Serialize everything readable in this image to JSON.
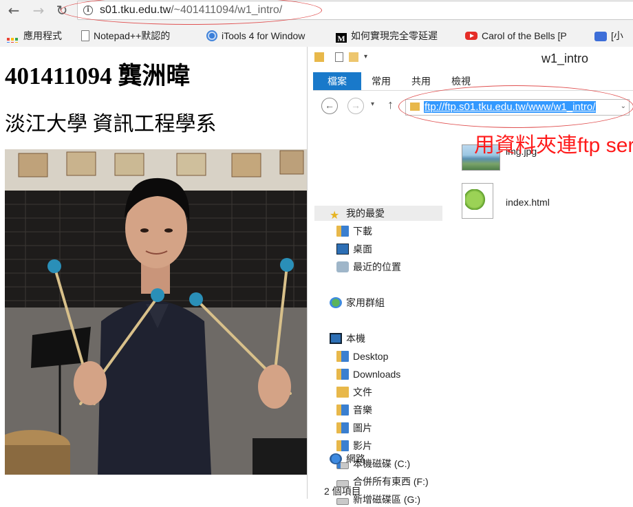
{
  "browser": {
    "url_host": "s01.tku.edu.tw",
    "url_path": "/~401411094/w1_intro/",
    "bookmarks": [
      {
        "label": "應用程式",
        "icon": "apps-icon"
      },
      {
        "label": "Notepad++默認的",
        "icon": "document-icon"
      },
      {
        "label": "iTools 4 for Window",
        "icon": "itools-icon"
      },
      {
        "label": "如何實現完全零延遲",
        "icon": "m-icon"
      },
      {
        "label": "Carol of the Bells [P",
        "icon": "youtube-icon"
      },
      {
        "label": "[小",
        "icon": "chat-icon"
      }
    ]
  },
  "page": {
    "student_heading": "401411094 龔洲暐",
    "dept_heading": "淡江大學 資訊工程學系"
  },
  "explorer": {
    "title": "w1_intro",
    "ribbon_tabs": [
      "檔案",
      "常用",
      "共用",
      "檢視"
    ],
    "address": "ftp://ftp.s01.tku.edu.tw/www/w1_intro/",
    "annotation": "用資料夾連ftp server",
    "nav_items": [
      {
        "label": "我的最愛",
        "icon": "star-icon"
      },
      {
        "label": "下載",
        "icon": "downloads-folder-icon"
      },
      {
        "label": "桌面",
        "icon": "desktop-icon"
      },
      {
        "label": "最近的位置",
        "icon": "recent-icon"
      },
      {
        "label": "家用群組",
        "icon": "homegroup-icon"
      },
      {
        "label": "本機",
        "icon": "pc-icon"
      },
      {
        "label": "Desktop",
        "icon": "folder-icon"
      },
      {
        "label": "Downloads",
        "icon": "folder-icon"
      },
      {
        "label": "文件",
        "icon": "documents-folder-icon"
      },
      {
        "label": "音樂",
        "icon": "music-folder-icon"
      },
      {
        "label": "圖片",
        "icon": "pictures-folder-icon"
      },
      {
        "label": "影片",
        "icon": "videos-folder-icon"
      },
      {
        "label": "本機磁碟 (C:)",
        "icon": "drive-c-icon"
      },
      {
        "label": "合併所有東西 (F:)",
        "icon": "drive-icon"
      },
      {
        "label": "新增磁碟區 (G:)",
        "icon": "drive-icon"
      },
      {
        "label": "網路",
        "icon": "network-icon"
      }
    ],
    "files": [
      {
        "name": "img.jpg",
        "icon": "image-file-icon"
      },
      {
        "name": "index.html",
        "icon": "notepadpp-file-icon"
      }
    ],
    "status": "2 個項目",
    "colors": {
      "ribbon_active": "#1979ca",
      "annotation": "#ff1a1a",
      "address_highlight": "#3399ff"
    }
  }
}
